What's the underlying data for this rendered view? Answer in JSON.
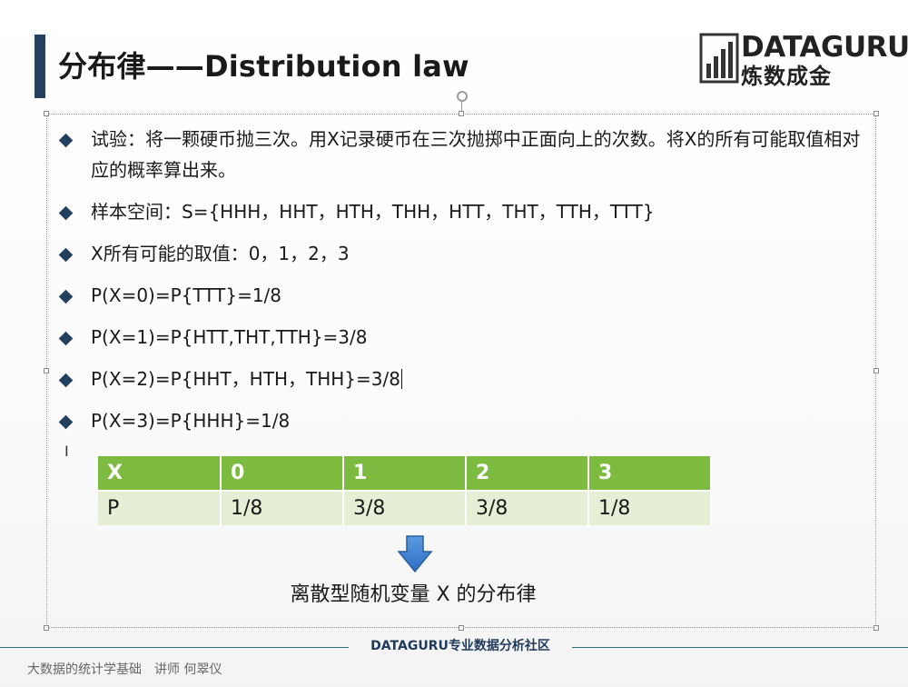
{
  "slide": {
    "title": "分布律——Distribution law",
    "logo": {
      "top": "DATAGURU",
      "bottom": "炼数成金"
    },
    "bullets": [
      "试验：将一颗硬币抛三次。用X记录硬币在三次抛掷中正面向上的次数。将X的所有可能取值相对应的概率算出来。",
      "样本空间：S={HHH，HHT，HTH，THH，HTT，THT，TTH，TTT}",
      "X所有可能的取值：0，1，2，3",
      "P(X=0)=P{TTT}=1/8",
      "P(X=1)=P{HTT,THT,TTH}=3/8",
      "P(X=2)=P{HHT，HTH，THH}=3/8",
      "P(X=3)=P{HHH}=1/8"
    ],
    "table": {
      "header": [
        "X",
        "0",
        "1",
        "2",
        "3"
      ],
      "row": [
        "P",
        "1/8",
        "3/8",
        "3/8",
        "1/8"
      ]
    },
    "caption": "离散型随机变量 X 的分布律"
  },
  "footer": {
    "center": "DATAGURU专业数据分析社区",
    "left": "大数据的统计学基础　讲师 何翠仪"
  },
  "colors": {
    "accent": "#23415f",
    "table_header": "#7cbb3f",
    "table_body": "#e6efd6",
    "arrow": "#3a7fd0"
  }
}
